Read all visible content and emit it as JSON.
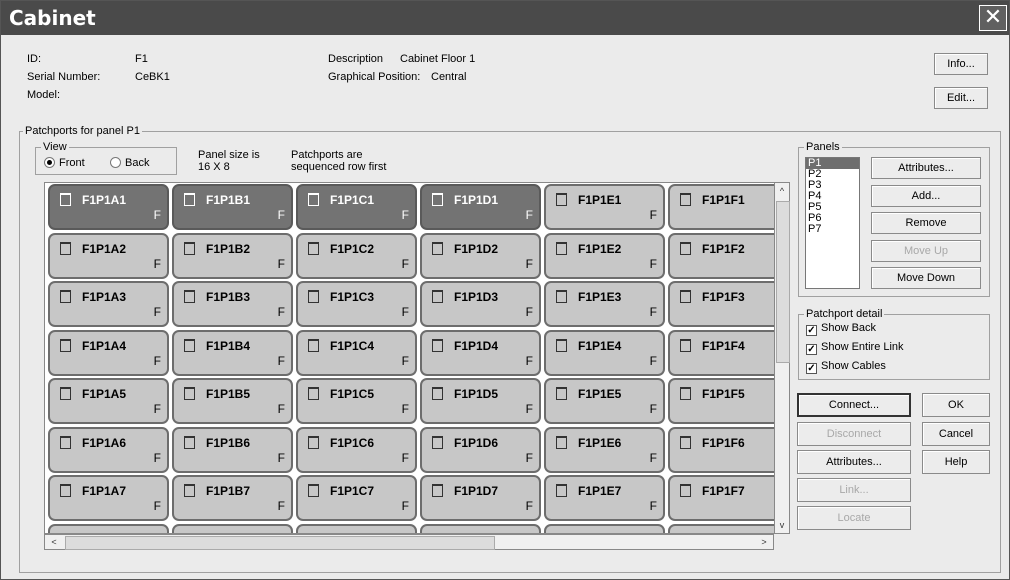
{
  "window": {
    "title": "Cabinet",
    "close_glyph": "✕"
  },
  "info": {
    "id_label": "ID:",
    "id_value": "F1",
    "serial_label": "Serial Number:",
    "serial_value": "CeBK1",
    "model_label": "Model:",
    "model_value": "",
    "description_label": "Description",
    "description_value": "Cabinet Floor 1",
    "graphical_label": "Graphical Position:",
    "graphical_value": "Central"
  },
  "buttons": {
    "info": "Info...",
    "edit": "Edit...",
    "attributes_panel": "Attributes...",
    "add": "Add...",
    "remove": "Remove",
    "move_up": "Move Up",
    "move_down": "Move Down",
    "connect": "Connect...",
    "disconnect": "Disconnect",
    "attributes_port": "Attributes...",
    "link": "Link...",
    "locate": "Locate",
    "ok": "OK",
    "cancel": "Cancel",
    "help": "Help"
  },
  "patchports": {
    "group_title": "Patchports for panel P1",
    "view_title": "View",
    "front_label": "Front",
    "back_label": "Back",
    "view_selected": "Front",
    "panel_size_line1": "Panel size is",
    "panel_size_line2": "16 X 8",
    "sequence_line1": "Patchports are",
    "sequence_line2": "sequenced row first"
  },
  "panels": {
    "title": "Panels",
    "items": [
      "P1",
      "P2",
      "P3",
      "P4",
      "P5",
      "P6",
      "P7"
    ],
    "selected": "P1"
  },
  "patchport_detail": {
    "title": "Patchport detail",
    "options": [
      {
        "label": "Show Back",
        "checked": true
      },
      {
        "label": "Show Entire Link",
        "checked": true
      },
      {
        "label": "Show Cables",
        "checked": true
      }
    ]
  },
  "grid": {
    "columns": [
      "A",
      "B",
      "C",
      "D",
      "E",
      "F"
    ],
    "rows": [
      1,
      2,
      3,
      4,
      5,
      6,
      7
    ],
    "prefix": "F1P1",
    "side_label": "F",
    "selected": [
      "F1P1A1",
      "F1P1B1",
      "F1P1C1",
      "F1P1D1"
    ]
  },
  "scroll": {
    "up": "^",
    "down": "v",
    "left": "<",
    "right": ">"
  },
  "colors": {
    "selected_port": "#737373",
    "port": "#c7c7c7",
    "titlebar": "#4a4a4a"
  }
}
